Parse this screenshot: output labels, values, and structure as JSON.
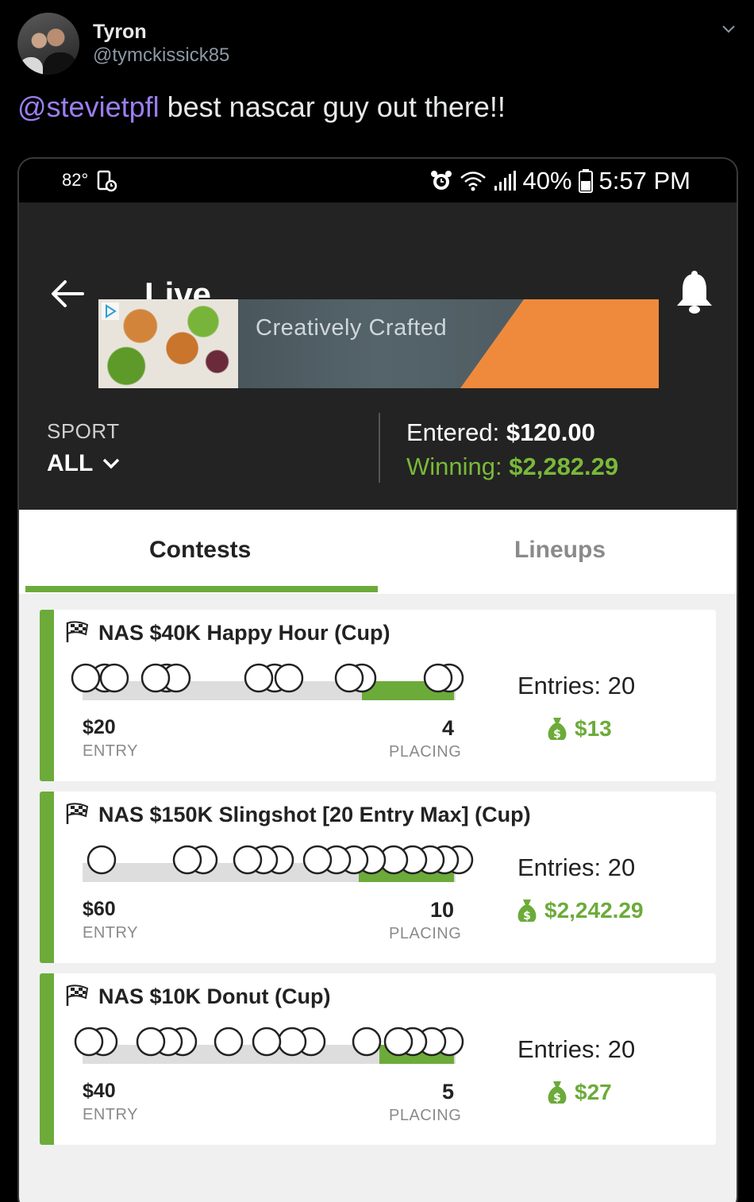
{
  "tweet": {
    "name": "Tyron",
    "handle": "@tymckissick85",
    "mention": "@stevietpfl",
    "text": " best nascar guy out there!!"
  },
  "statusbar": {
    "temp": "82°",
    "battery": "40%",
    "time": "5:57 PM"
  },
  "app": {
    "title": "Live",
    "ad_text": "Creatively Crafted",
    "sport_label": "SPORT",
    "sport_value": "ALL",
    "entered_label": "Entered:",
    "entered_value": "$120.00",
    "winning_label": "Winning:",
    "winning_value": "$2,282.29"
  },
  "tabs": {
    "contests": "Contests",
    "lineups": "Lineups"
  },
  "contests": [
    {
      "title": "NAS $40K Happy Hour (Cup)",
      "entry": "$20",
      "entry_label": "ENTRY",
      "placing": "4",
      "placing_label": "PLACING",
      "entries": "Entries: 20",
      "prize": "$13"
    },
    {
      "title": "NAS $150K Slingshot [20 Entry Max] (Cup)",
      "entry": "$60",
      "entry_label": "ENTRY",
      "placing": "10",
      "placing_label": "PLACING",
      "entries": "Entries: 20",
      "prize": "$2,242.29"
    },
    {
      "title": "NAS $10K Donut (Cup)",
      "entry": "$40",
      "entry_label": "ENTRY",
      "placing": "5",
      "placing_label": "PLACING",
      "entries": "Entries: 20",
      "prize": "$27"
    }
  ],
  "colors": {
    "accent_green": "#6cab3a",
    "mention_purple": "#9b7ef0",
    "ad_orange": "#ef8a3d"
  }
}
